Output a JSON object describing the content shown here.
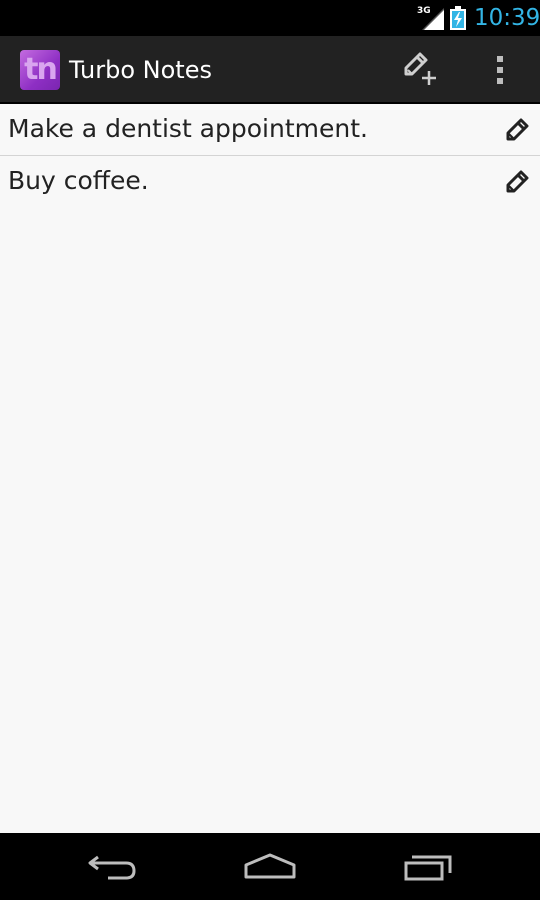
{
  "status_bar": {
    "network_label": "3G",
    "time": "10:39",
    "clock_color": "#33b5e5"
  },
  "action_bar": {
    "app_icon_text": "tn",
    "title": "Turbo Notes",
    "actions": [
      "add-note-icon",
      "overflow-menu-icon"
    ]
  },
  "notes": [
    {
      "text": "Make a dentist appointment.",
      "action_icon": "pencil-icon"
    },
    {
      "text": "Buy coffee.",
      "action_icon": "pencil-icon"
    }
  ],
  "nav_bar": {
    "buttons": [
      "back-icon",
      "home-icon",
      "recent-apps-icon"
    ]
  }
}
